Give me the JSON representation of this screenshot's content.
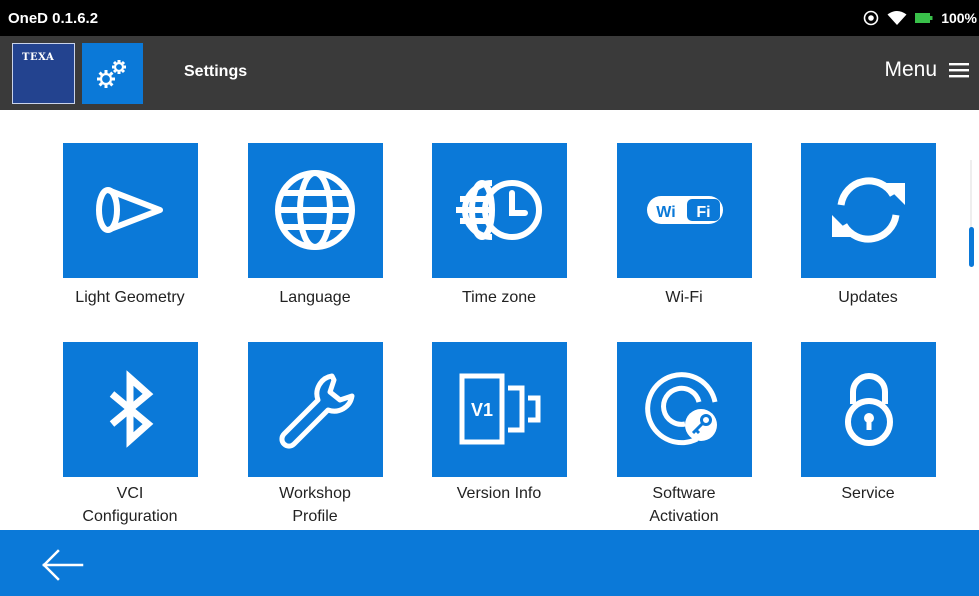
{
  "status_bar": {
    "app_version": "OneD 0.1.6.2",
    "battery": "100%",
    "icons": [
      "location-icon",
      "wifi-signal-icon",
      "battery-icon"
    ]
  },
  "header": {
    "logo_text": "TEXA",
    "title": "Settings",
    "menu_label": "Menu",
    "icons": [
      "gears-icon",
      "hamburger-icon"
    ]
  },
  "tiles": [
    {
      "label": "Light Geometry",
      "icon": "light-cone-icon"
    },
    {
      "label": "Language",
      "icon": "globe-icon"
    },
    {
      "label": "Time zone",
      "icon": "globe-clock-icon"
    },
    {
      "label": "Wi-Fi",
      "icon": "wifi-logo-icon"
    },
    {
      "label": "Updates",
      "icon": "sync-icon"
    },
    {
      "label_line1": "VCI",
      "label_line2": "Configuration",
      "icon": "bluetooth-icon"
    },
    {
      "label_line1": "Workshop",
      "label_line2": "Profile",
      "icon": "wrench-icon"
    },
    {
      "label": "Version Info",
      "icon": "version-icon",
      "badge": "V1"
    },
    {
      "label_line1": "Software",
      "label_line2": "Activation",
      "icon": "disc-key-icon"
    },
    {
      "label": "Service",
      "icon": "padlock-icon"
    }
  ],
  "footer": {
    "icons": [
      "back-arrow-icon"
    ]
  },
  "colors": {
    "accent": "#0b79d8",
    "header_bg": "#3a3a3a",
    "logo_bg": "#23438f"
  }
}
